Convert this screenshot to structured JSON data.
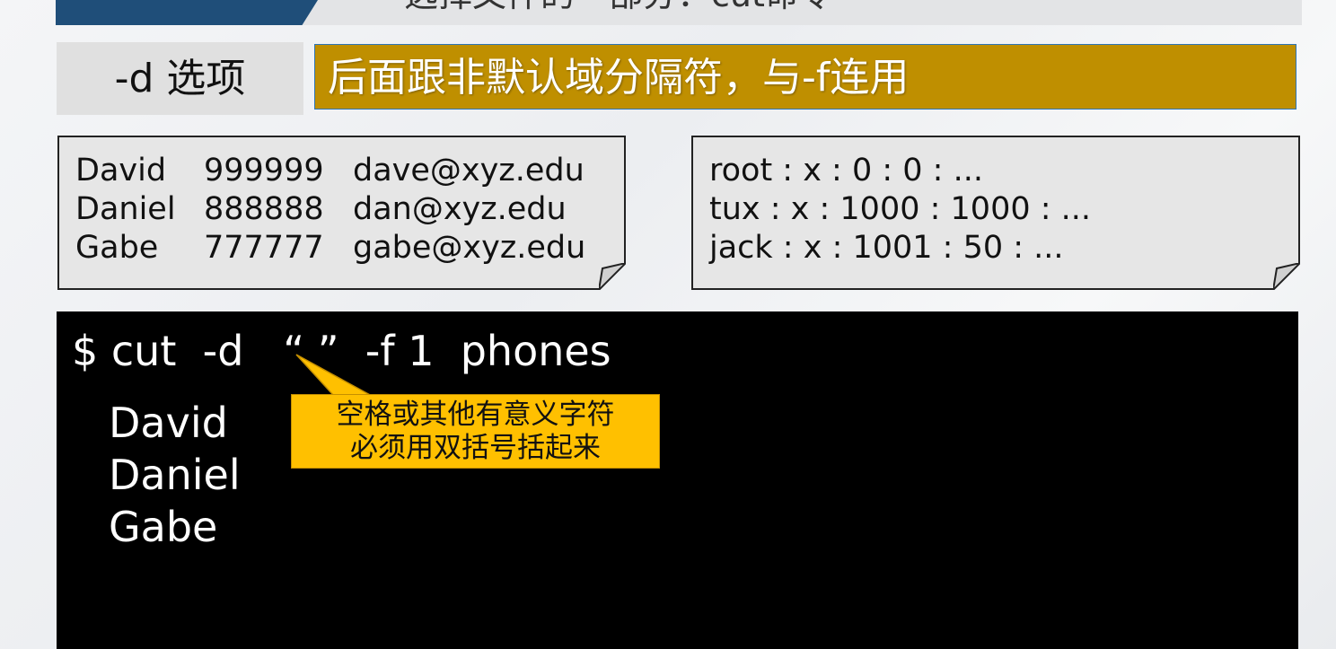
{
  "header": {
    "title": "选择文件的一部分：cut命令"
  },
  "option": {
    "label": "-d  选项",
    "description": "后面跟非默认域分隔符，与-f连用"
  },
  "phones_file": {
    "rows": [
      [
        "David",
        "999999",
        "dave@xyz.edu"
      ],
      [
        "Daniel",
        "888888",
        "dan@xyz.edu"
      ],
      [
        "Gabe",
        "777777",
        "gabe@xyz.edu"
      ]
    ]
  },
  "passwd_file": {
    "lines": [
      "root : x : 0 : 0 : ...",
      "tux : x : 1000 : 1000 :  ...",
      "jack : x : 1001 : 50 : ..."
    ]
  },
  "terminal": {
    "command": "$ cut  -d   “ ”  -f 1  phones",
    "output": [
      "David",
      "Daniel",
      "Gabe"
    ]
  },
  "callout": {
    "line1": "空格或其他有意义字符",
    "line2": "必须用双括号括起来"
  },
  "colors": {
    "header_tab": "#1f4e79",
    "option_desc_bg": "#bf8f00",
    "callout_bg": "#ffc000",
    "terminal_bg": "#000000"
  }
}
